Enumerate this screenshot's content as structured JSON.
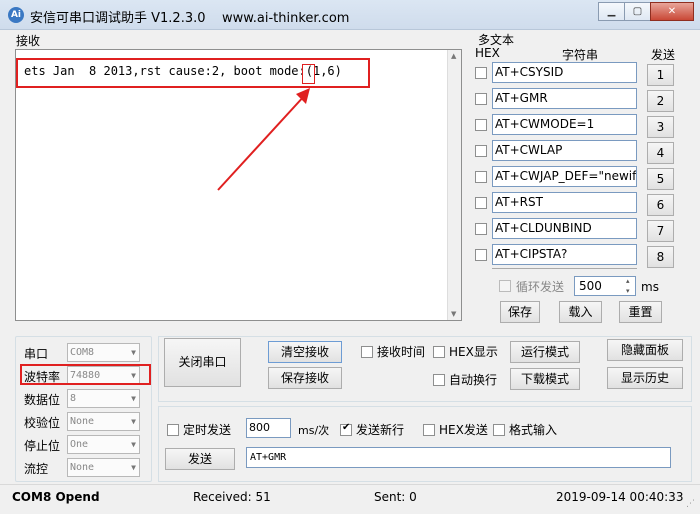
{
  "window": {
    "title": "安信可串口调试助手 V1.2.3.0    www.ai-thinker.com",
    "icon_text": "Ai",
    "minimize": "▁",
    "maximize": "▢",
    "close": "✕"
  },
  "receive": {
    "label": "接收",
    "content": "ets Jan  8 2013,rst cause:2, boot mode:(1,6)"
  },
  "multi": {
    "title": "多文本",
    "hex_header": "HEX",
    "string_header": "字符串",
    "send_header": "发送",
    "rows": [
      {
        "text": "AT+CSYSID",
        "num": "1"
      },
      {
        "text": "AT+GMR",
        "num": "2"
      },
      {
        "text": "AT+CWMODE=1",
        "num": "3"
      },
      {
        "text": "AT+CWLAP",
        "num": "4"
      },
      {
        "text": "AT+CWJAP_DEF=\"newifi_",
        "num": "5"
      },
      {
        "text": "AT+RST",
        "num": "6"
      },
      {
        "text": "AT+CLDUNBIND",
        "num": "7"
      },
      {
        "text": "AT+CIPSTA?",
        "num": "8"
      }
    ],
    "loop_send_label": "循环发送",
    "loop_value": "500",
    "loop_unit": "ms",
    "save": "保存",
    "load": "载入",
    "reset": "重置"
  },
  "settings": {
    "port_label": "串口",
    "port_value": "COM8",
    "baud_label": "波特率",
    "baud_value": "74880",
    "databits_label": "数据位",
    "databits_value": "8",
    "parity_label": "校验位",
    "parity_value": "None",
    "stopbits_label": "停止位",
    "stopbits_value": "One",
    "flow_label": "流控",
    "flow_value": "None"
  },
  "controls": {
    "close_port": "关闭串口",
    "clear_recv": "清空接收",
    "save_recv": "保存接收",
    "recv_time": "接收时间",
    "hex_display": "HEX显示",
    "run_mode": "运行模式",
    "hide_panel": "隐藏面板",
    "auto_wrap": "自动换行",
    "download_mode": "下载模式",
    "show_history": "显示历史"
  },
  "send": {
    "timed_send": "定时发送",
    "interval": "800",
    "interval_unit": "ms/次",
    "send_newline": "发送新行",
    "hex_send": "HEX发送",
    "format_input": "格式输入",
    "send_button": "发送",
    "send_text": "AT+GMR"
  },
  "status": {
    "port_state": "COM8 Opend",
    "received": "Received: 51",
    "sent": "Sent: 0",
    "datetime": "2019-09-14 00:40:33"
  },
  "colors": {
    "highlight": "#e02020"
  }
}
